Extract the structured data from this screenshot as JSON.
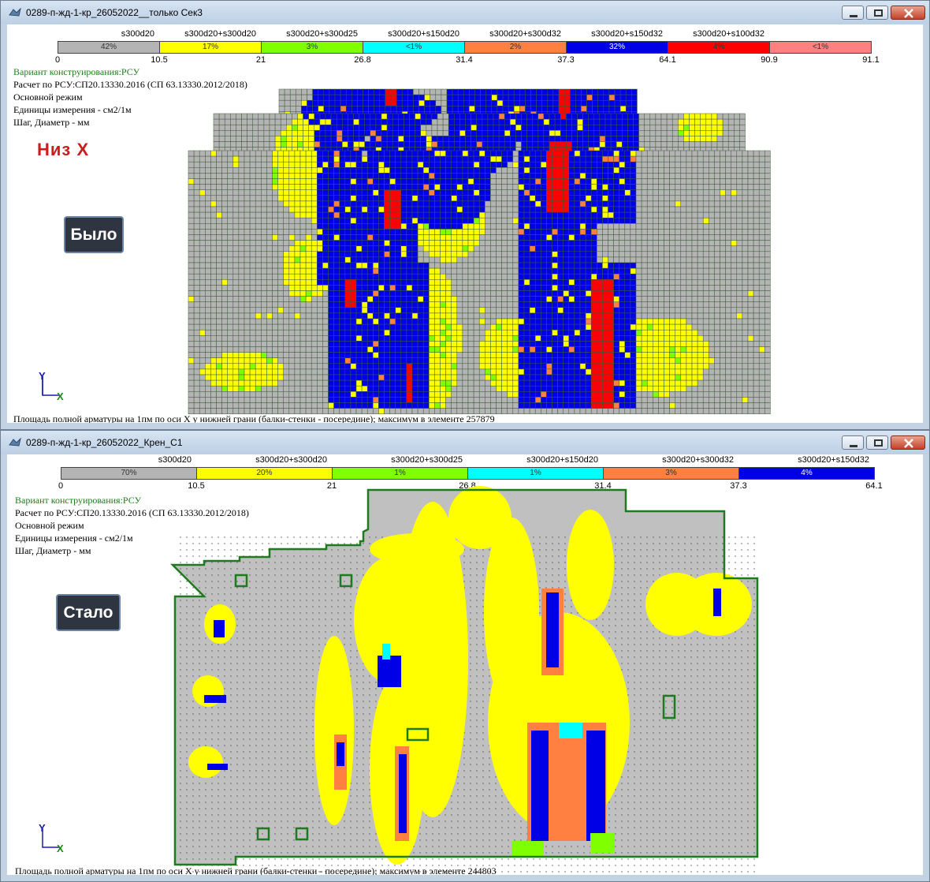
{
  "window1": {
    "title": "0289-п-жд-1-кр_26052022__только Сек3",
    "legend": {
      "names": [
        "s300d20",
        "s300d20+s300d20",
        "s300d20+s300d25",
        "s300d20+s150d20",
        "s300d20+s300d32",
        "s300d20+s150d32",
        "s300d20+s100d32"
      ],
      "percents": [
        "42%",
        "17%",
        "3%",
        "<1%",
        "2%",
        "32%",
        "4%",
        "<1%"
      ],
      "colors": [
        "#b4b4b4",
        "#ffff00",
        "#80ff00",
        "#00ffff",
        "#ff8040",
        "#0000e6",
        "#ff0000",
        "#ff8080"
      ],
      "ticks": [
        "0",
        "10.5",
        "21",
        "26.8",
        "31.4",
        "37.3",
        "64.1",
        "90.9",
        "91.1"
      ]
    },
    "info": {
      "variant": "Вариант конструирования:РСУ",
      "calc": "Расчет по РСУ:СП20.13330.2016 (СП 63.13330.2012/2018)",
      "mode": "Основной режим",
      "units": "Единицы измерения - см2/1м",
      "step": "Шаг, Диаметр - мм"
    },
    "direction_label": "Низ X",
    "state_tag": "Было",
    "caption": "Площадь полной арматуры на 1пм по оси X у нижней грани (балки-стенки - посередине); максимум в элементе 257879"
  },
  "window2": {
    "title": "0289-п-жд-1-кр_26052022_Крен_С1",
    "legend": {
      "names": [
        "s300d20",
        "s300d20+s300d20",
        "s300d20+s300d25",
        "s300d20+s150d20",
        "s300d20+s300d32",
        "s300d20+s150d32"
      ],
      "percents": [
        "70%",
        "20%",
        "1%",
        "1%",
        "3%",
        "4%"
      ],
      "colors": [
        "#b4b4b4",
        "#ffff00",
        "#80ff00",
        "#00ffff",
        "#ff8040",
        "#0000e6"
      ],
      "ticks": [
        "0",
        "10.5",
        "21",
        "26.8",
        "31.4",
        "37.3",
        "64.1"
      ]
    },
    "info": {
      "variant": "Вариант конструирования:РСУ",
      "calc": "Расчет по РСУ:СП20.13330.2016 (СП 63.13330.2012/2018)",
      "mode": "Основной режим",
      "units": "Единицы измерения - см2/1м",
      "step": "Шаг, Диаметр - мм"
    },
    "state_tag": "Стало",
    "caption": "Площадь полной арматуры на 1пм по оси X у нижней грани (балки-стенки - посередине); максимум в элементе 244803"
  },
  "axes": {
    "y": "Y",
    "x": "X"
  },
  "colors": {
    "titlebar": "#c4d3e4",
    "close_button": "#c4412a",
    "contour_outline": "#1e7a1e",
    "direction_label": "#c81e1e"
  }
}
